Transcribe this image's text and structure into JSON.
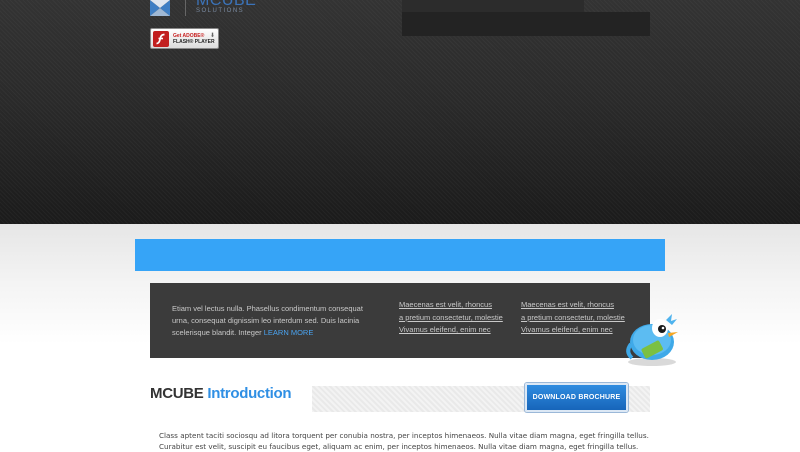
{
  "header": {
    "logo_name": "MCUBE",
    "logo_sub": "SOLUTIONS",
    "flash_badge": {
      "line1": "Get ADOBE®",
      "line2": "FLASH® PLAYER"
    }
  },
  "info_box": {
    "text": "Etiam vel lectus nulla. Phasellus condimentum consequat urna, consequat dignissim leo interdum sed. Duis lacinia scelerisque blandit. Integer ",
    "more_label": "LEARN MORE",
    "links_col1": [
      "Maecenas est velit, rhoncus",
      "a pretium consectetur, molestie",
      "Vivamus eleifend, enim nec"
    ],
    "links_col2": [
      "Maecenas est velit, rhoncus",
      "a pretium consectetur, molestie",
      "Vivamus eleifend, enim nec"
    ]
  },
  "intro": {
    "title_plain": "MCUBE",
    "title_accent": "Introduction",
    "download_label": "DOWNLOAD BROCHURE",
    "body_lines": [
      "Class aptent taciti sociosqu ad litora torquent per conubia nostra, per inceptos himenaeos. Nulla vitae diam magna, eget fringilla tellus.",
      "Curabitur est velit, suscipit eu faucibus eget, aliquam ac enim, per inceptos himenaeos. Nulla vitae diam magna, eget fringilla tellus."
    ]
  },
  "colors": {
    "accent_blue": "#36a4f7",
    "button_blue": "#1f78d1",
    "dark_hero": "#222222"
  },
  "icons": {
    "logo": "cube-logo-icon",
    "flash": "flash-player-icon",
    "mascot": "twitter-bird-icon"
  }
}
